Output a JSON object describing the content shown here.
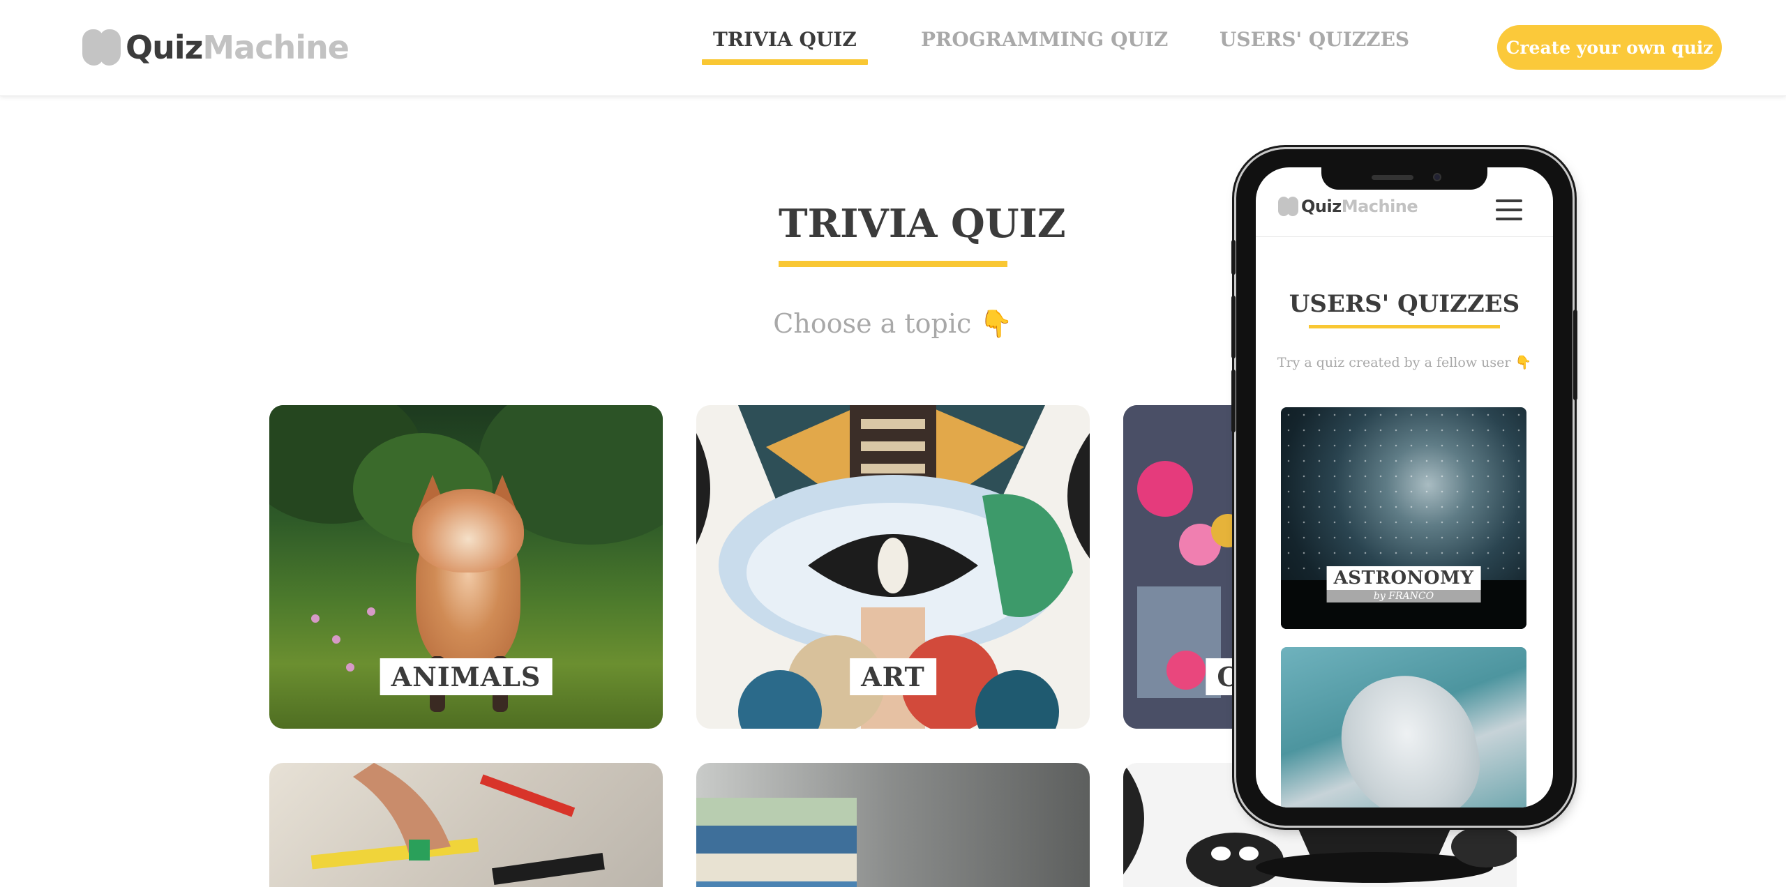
{
  "header": {
    "logo": {
      "part1": "Quiz",
      "part2": "Machine"
    },
    "nav": [
      {
        "label": "TRIVIA QUIZ",
        "active": true
      },
      {
        "label": "PROGRAMMING QUIZ",
        "active": false
      },
      {
        "label": "USERS' QUIZZES",
        "active": false
      }
    ],
    "cta_label": "Create your own quiz"
  },
  "main": {
    "title": "TRIVIA QUIZ",
    "subtitle": "Choose a topic 👇",
    "topics": [
      {
        "label": "ANIMALS"
      },
      {
        "label": "ART"
      },
      {
        "label": "C"
      }
    ]
  },
  "phone": {
    "logo": {
      "part1": "Quiz",
      "part2": "Machine"
    },
    "title": "USERS' QUIZZES",
    "subtitle": "Try a quiz created by a fellow user 👇",
    "cards": [
      {
        "label": "ASTRONOMY",
        "author": "by FRANCO"
      }
    ]
  },
  "colors": {
    "accent": "#f9c733",
    "cta": "#fbc93a",
    "text": "#3b3b3b",
    "muted": "#a8a8a8"
  },
  "icons": [
    "brain-logo-icon",
    "hamburger-menu-icon"
  ]
}
